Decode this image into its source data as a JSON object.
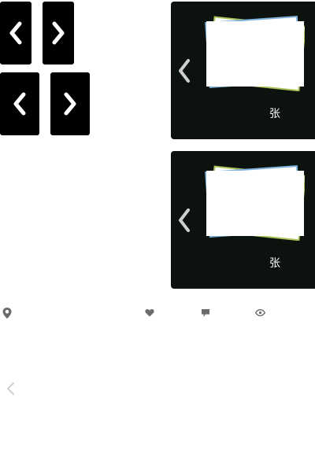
{
  "nav_buttons": [
    {
      "name": "prev",
      "icon": "chevron-left-icon",
      "glyph": "❮"
    },
    {
      "name": "next",
      "icon": "chevron-right-icon",
      "glyph": "❯"
    },
    {
      "name": "prev",
      "icon": "chevron-left-icon",
      "glyph": "❮"
    },
    {
      "name": "next",
      "icon": "chevron-right-icon",
      "glyph": "❯"
    }
  ],
  "albums": [
    {
      "count_label": "张",
      "arrow_icon": "chevron-left-icon"
    },
    {
      "count_label": "张",
      "arrow_icon": "chevron-left-icon"
    }
  ],
  "meta_row": {
    "location_icon": "location-pin-icon",
    "like_icon": "heart-icon",
    "comment_icon": "comment-icon",
    "view_icon": "eye-icon"
  },
  "bottom": {
    "back_icon": "chevron-left-icon"
  },
  "colors": {
    "card_bg": "#0c120e",
    "button_bg": "#000000",
    "icon_gray": "#6b6b6b",
    "arrow_light": "#cccccc",
    "photo_blue": "#7fb2dc",
    "photo_green": "#a9c25a"
  }
}
